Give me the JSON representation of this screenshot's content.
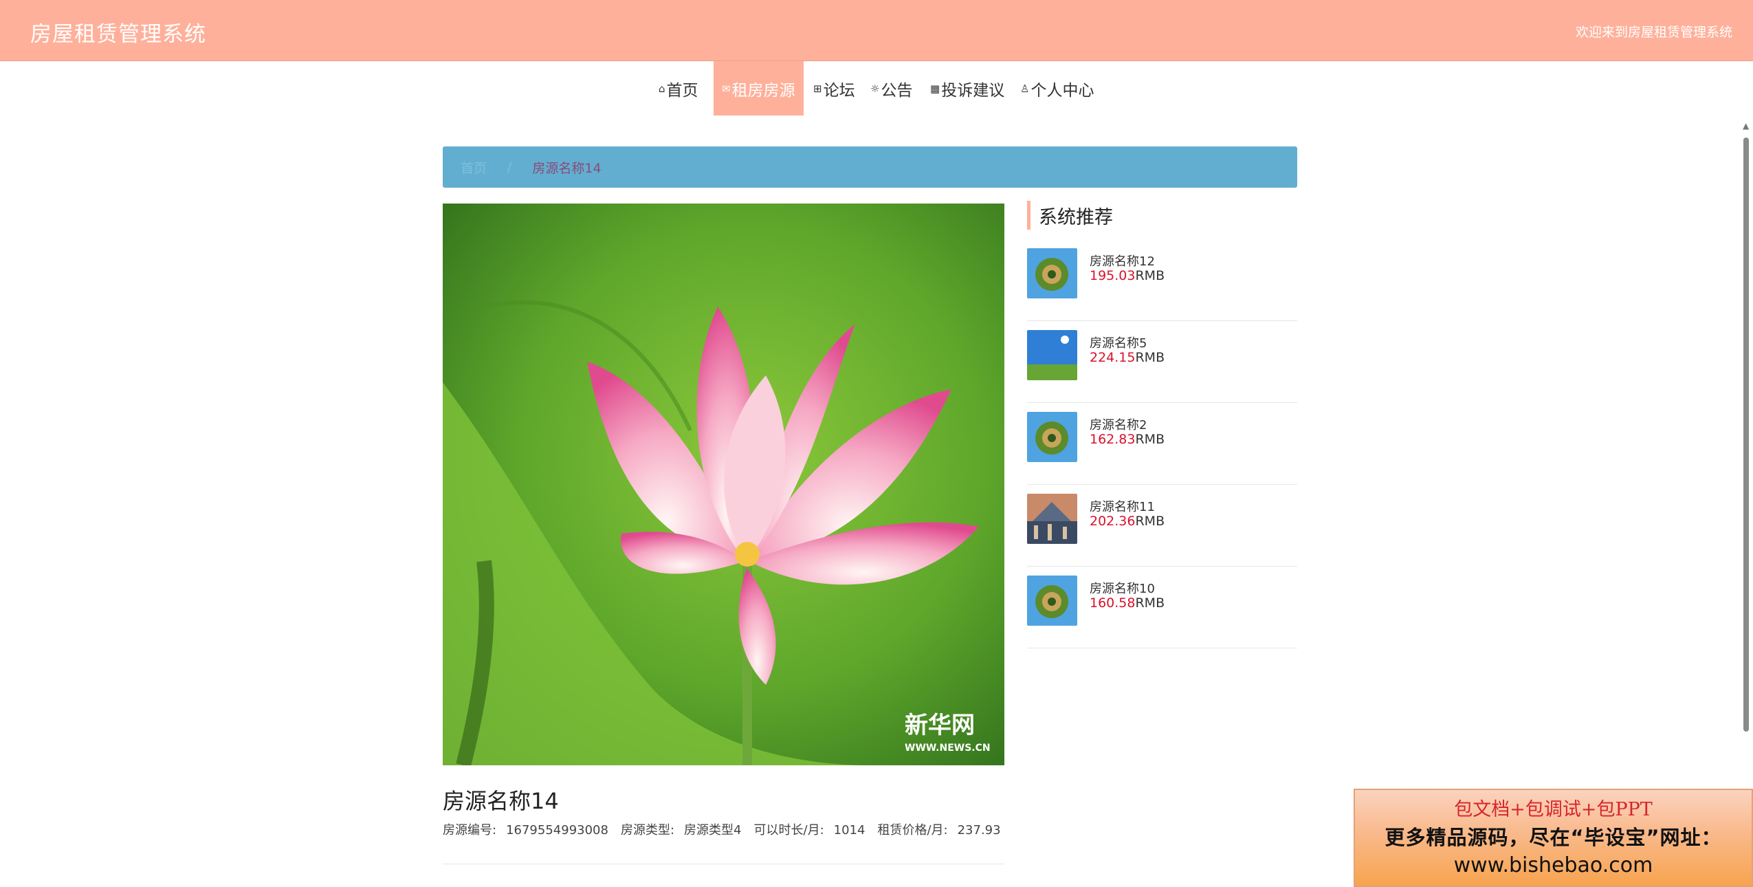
{
  "header": {
    "site_title": "房屋租赁管理系统",
    "welcome": "欢迎来到房屋租赁管理系统"
  },
  "nav": {
    "items": [
      {
        "icon": "home-icon",
        "label": "首页",
        "active": false
      },
      {
        "icon": "mail-icon",
        "label": "租房房源",
        "active": true
      },
      {
        "icon": "forum-icon",
        "label": "论坛",
        "active": false
      },
      {
        "icon": "announcement-icon",
        "label": "公告",
        "active": false
      },
      {
        "icon": "complaint-icon",
        "label": "投诉建议",
        "active": false
      },
      {
        "icon": "user-icon",
        "label": "个人中心",
        "active": false
      }
    ]
  },
  "breadcrumb": {
    "home": "首页",
    "separator": "/",
    "current": "房源名称14"
  },
  "recommend": {
    "title": "系统推荐",
    "currency": "RMB",
    "items": [
      {
        "name": "房源名称12",
        "price": "195.03",
        "thumb": "planet"
      },
      {
        "name": "房源名称5",
        "price": "224.15",
        "thumb": "sky-field"
      },
      {
        "name": "房源名称2",
        "price": "162.83",
        "thumb": "planet"
      },
      {
        "name": "房源名称11",
        "price": "202.36",
        "thumb": "city"
      },
      {
        "name": "房源名称10",
        "price": "160.58",
        "thumb": "planet"
      }
    ]
  },
  "detail": {
    "title": "房源名称14",
    "image_watermark": "新华网",
    "image_watermark_url": "WWW.NEWS.CN",
    "meta": [
      {
        "label": "房源编号:",
        "value": "1679554993008"
      },
      {
        "label": "房源类型:",
        "value": "房源类型4"
      },
      {
        "label": "可以时长/月:",
        "value": "1014"
      },
      {
        "label": "租赁价格/月:",
        "value": "237.93"
      }
    ]
  },
  "promo": {
    "line1": "包文档+包调试+包PPT",
    "line2": "更多精品源码，尽在“毕设宝”网址：",
    "line3": "www.bishebao.com"
  },
  "colors": {
    "header_bg": "#ffb09a",
    "breadcrumb_bg": "#62aed0",
    "price": "#d9122a"
  }
}
